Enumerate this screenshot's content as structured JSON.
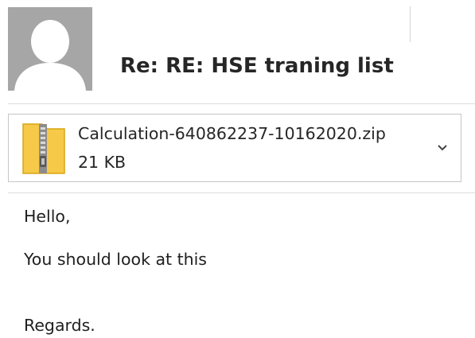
{
  "header": {
    "subject": "Re: RE: HSE traning list"
  },
  "attachment": {
    "filename": "Calculation-640862237-10162020.zip",
    "size": "21 KB",
    "icon": "zip-folder-icon"
  },
  "body": {
    "lines": [
      "Hello,",
      "You should look at this",
      "Regards."
    ]
  },
  "colors": {
    "avatar_bg": "#a6a6a6",
    "zip_folder": "#f7c948"
  }
}
